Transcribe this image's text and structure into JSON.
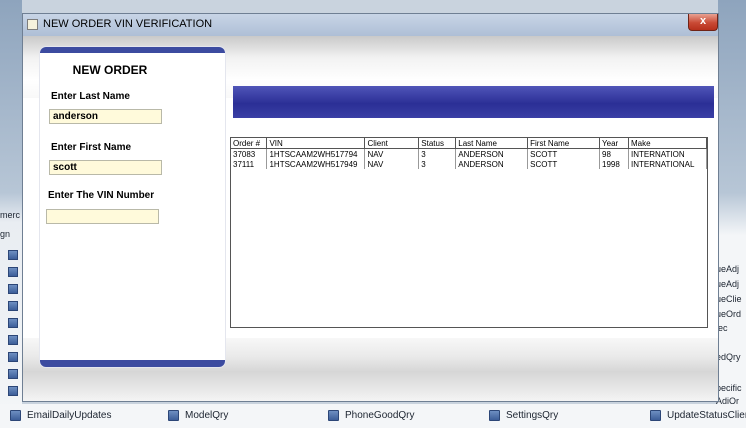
{
  "window": {
    "title": "NEW ORDER VIN VERIFICATION",
    "close_glyph": "x"
  },
  "form": {
    "heading": "NEW ORDER",
    "last_name": {
      "label": "Enter Last Name",
      "value": "anderson"
    },
    "first_name": {
      "label": "Enter First Name",
      "value": "scott"
    },
    "vin": {
      "label": "Enter The VIN Number",
      "value": ""
    }
  },
  "results": {
    "columns": [
      "Order #",
      "VIN",
      "Client",
      "Status",
      "Last Name",
      "First Name",
      "Year",
      "Make"
    ],
    "rows": [
      [
        "37083",
        "1HTSCAAM2WH517794",
        "NAV",
        "3",
        "ANDERSON",
        "SCOTT",
        "98",
        "INTERNATION"
      ],
      [
        "37111",
        "1HTSCAAM2WH517949",
        "NAV",
        "3",
        "ANDERSON",
        "SCOTT",
        "1998",
        "INTERNATIONAL"
      ]
    ]
  },
  "background": {
    "left_fragments": [
      "merc",
      "gn"
    ],
    "right_items": [
      "ueAdj",
      "ueAdj",
      "ueClie",
      "ueOrd",
      "lec",
      "edQry",
      "pecific",
      "AdjQr"
    ],
    "bottom_items": [
      "EmailDailyUpdates",
      "ModelQry",
      "PhoneGoodQry",
      "SettingsQry",
      "UpdateStatusClient"
    ]
  },
  "colors": {
    "panel_cap": "#3c4ba0",
    "header_bar": "#2b2f96",
    "field_fill": "#fffadb",
    "close_button": "#c94a35"
  }
}
